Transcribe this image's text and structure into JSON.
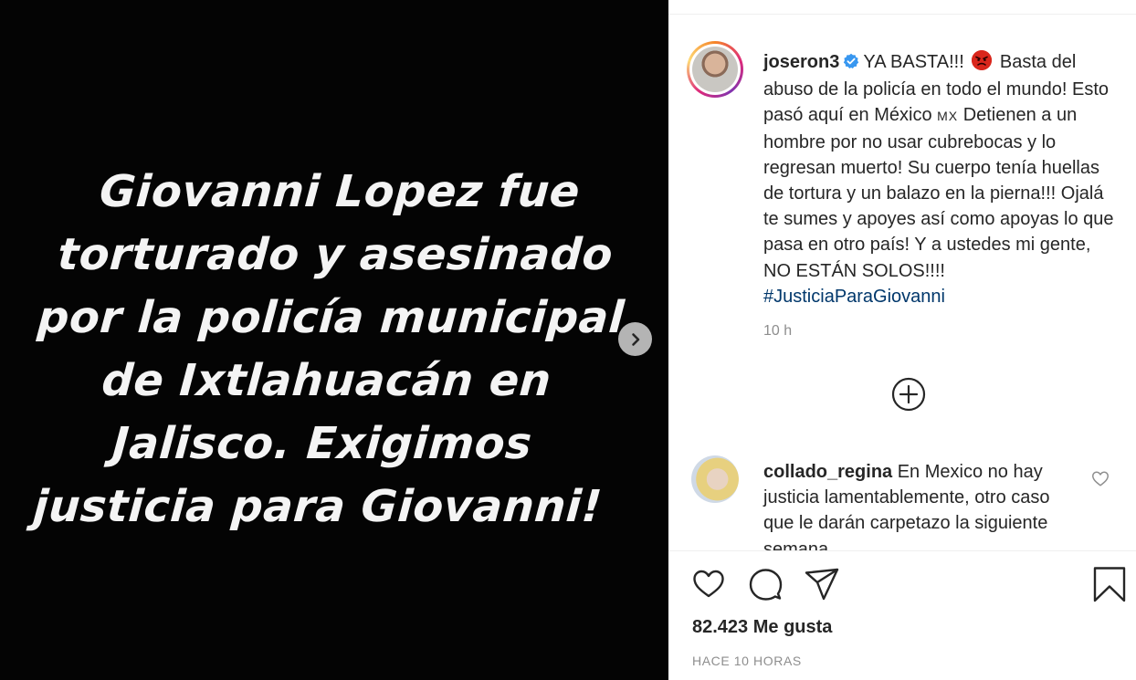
{
  "media": {
    "story_lines": [
      "Giovanni Lopez fue",
      "torturado y asesinado",
      "por la policía municipal",
      "de Ixtlahuacán en",
      "Jalisco. Exigimos",
      "justicia para Giovanni!"
    ],
    "next_icon": "chevron-right-icon"
  },
  "post": {
    "username": "joseron3",
    "verified_icon": "verified-badge-icon",
    "caption_1": "YA BASTA!!!",
    "emoji": "angry-face-emoji",
    "caption_2": "Basta del abuso de la policía en todo el mundo! Esto pasó aquí en México",
    "flag_text": "MX",
    "caption_3": "Detienen a un hombre por no usar cubrebocas y lo regresan muerto! Su cuerpo tenía huellas de tortura y un balazo en la pierna!!! Ojalá te sumes y apoyes así como apoyas lo que pasa en otro país! Y a ustedes mi gente, NO ESTÁN SOLOS!!!!",
    "hashtag": "#JusticiaParaGiovanni",
    "caption_time": "10 h",
    "load_more_icon": "plus-circle-icon"
  },
  "comment": {
    "username": "collado_regina",
    "text": "En Mexico no hay justicia lamentablemente, otro caso que le darán carpetazo la siguiente semana",
    "like_icon": "heart-outline-icon"
  },
  "actions": {
    "like_icon": "heart-icon",
    "comment_icon": "comment-bubble-icon",
    "share_icon": "paper-plane-icon",
    "save_icon": "bookmark-icon"
  },
  "stats": {
    "likes": "82.423 Me gusta",
    "posted": "HACE 10 HORAS"
  },
  "colors": {
    "link": "#00376b",
    "muted": "#8e8e8e",
    "text": "#262626",
    "emoji_red": "#d9261c",
    "verified_blue": "#3897f0"
  }
}
